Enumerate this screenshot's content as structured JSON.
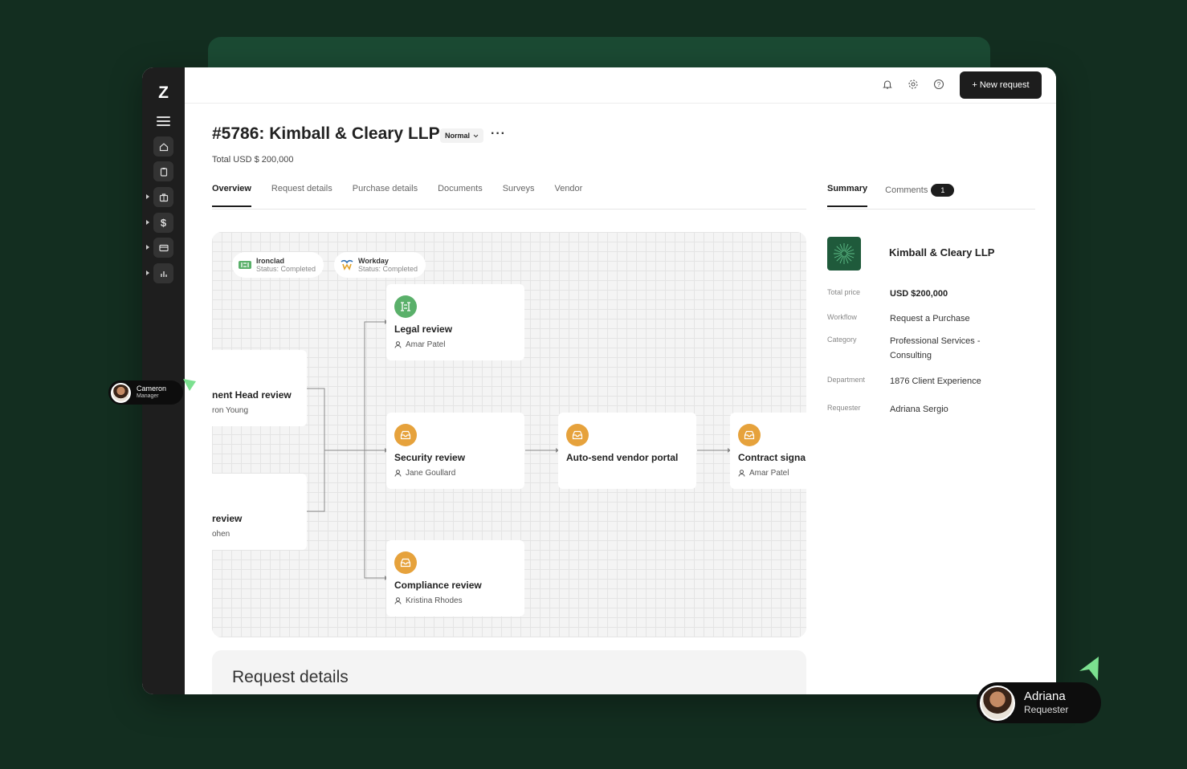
{
  "app": {
    "logo": "Z"
  },
  "sidebar": {
    "icons": [
      "menu-icon",
      "home-icon",
      "clipboard-icon",
      "briefcase-icon",
      "dollar-icon",
      "card-icon",
      "chart-icon"
    ]
  },
  "topbar": {
    "icons": [
      "bell-icon",
      "gear-icon",
      "help-icon"
    ],
    "new_request_label": "+ New request"
  },
  "request": {
    "title": "#5786: Kimball & Cleary LLP",
    "priority": "Normal",
    "more": "···",
    "total": "Total USD $ 200,000"
  },
  "tabs": [
    "Overview",
    "Request details",
    "Purchase details",
    "Documents",
    "Surveys",
    "Vendor"
  ],
  "right_tabs": {
    "summary": "Summary",
    "comments": "Comments",
    "comments_count": "1"
  },
  "integrations": [
    {
      "name": "Ironclad",
      "status": "Status: Completed"
    },
    {
      "name": "Workday",
      "status": "Status: Completed"
    }
  ],
  "workflow": {
    "dept_head": {
      "title": "nent Head review",
      "person": "ron Young"
    },
    "other": {
      "title": "review",
      "person": "ohen"
    },
    "legal": {
      "title": "Legal review",
      "person": "Amar Patel"
    },
    "security": {
      "title": "Security review",
      "person": "Jane Goullard"
    },
    "compliance": {
      "title": "Compliance review",
      "person": "Kristina Rhodes"
    },
    "vendor_portal": {
      "title": "Auto-send vendor portal"
    },
    "contract": {
      "title": "Contract signa",
      "person": "Amar Patel"
    }
  },
  "request_details_heading": "Request details",
  "summary": {
    "company": "Kimball & Cleary LLP",
    "rows": [
      {
        "key": "Total price",
        "value": "USD $200,000"
      },
      {
        "key": "Workflow",
        "value": "Request a Purchase"
      },
      {
        "key": "Category",
        "value": "Professional Services - Consulting"
      },
      {
        "key": "Department",
        "value": "1876 Client Experience"
      },
      {
        "key": "Requester",
        "value": "Adriana Sergio"
      }
    ]
  },
  "collaborators": [
    {
      "name": "Cameron",
      "role": "Manager"
    },
    {
      "name": "Adriana",
      "role": "Requester"
    }
  ],
  "colors": {
    "background": "#132e20",
    "accent": "#1b4a33",
    "orange": "#e6a23c",
    "green": "#5ab06a",
    "pointer": "#7be08f"
  }
}
